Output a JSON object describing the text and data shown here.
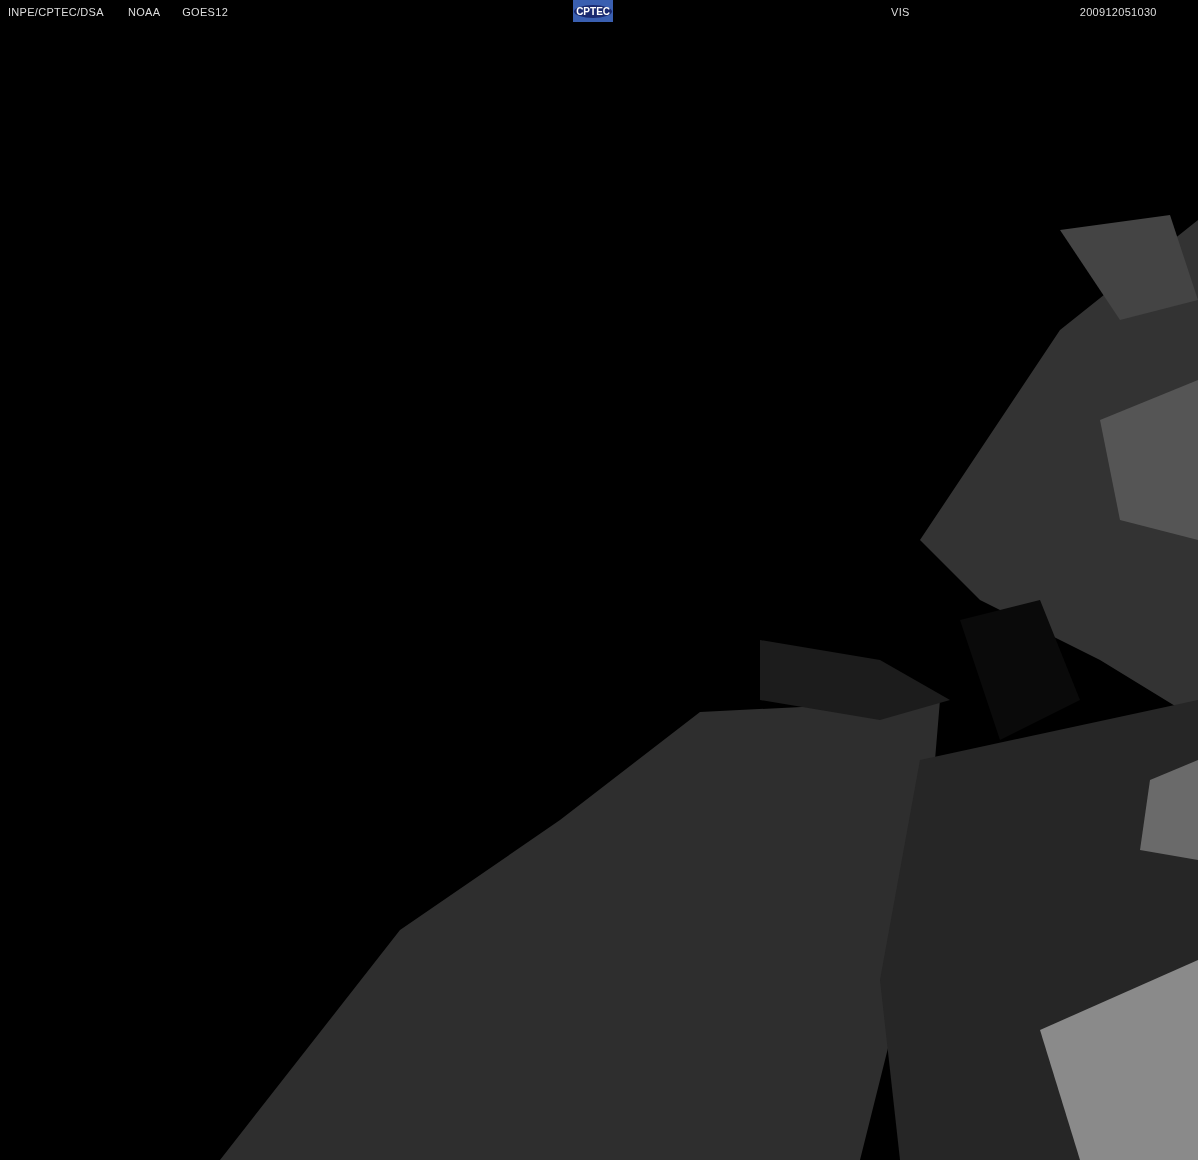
{
  "header": {
    "labels": [
      {
        "text": "INPE/CPTEC/DSA"
      },
      {
        "text": "NOAA"
      },
      {
        "text": "GOES12"
      }
    ],
    "logo": "CPTEC",
    "channel": "VIS",
    "timestamp": "200912051030"
  }
}
